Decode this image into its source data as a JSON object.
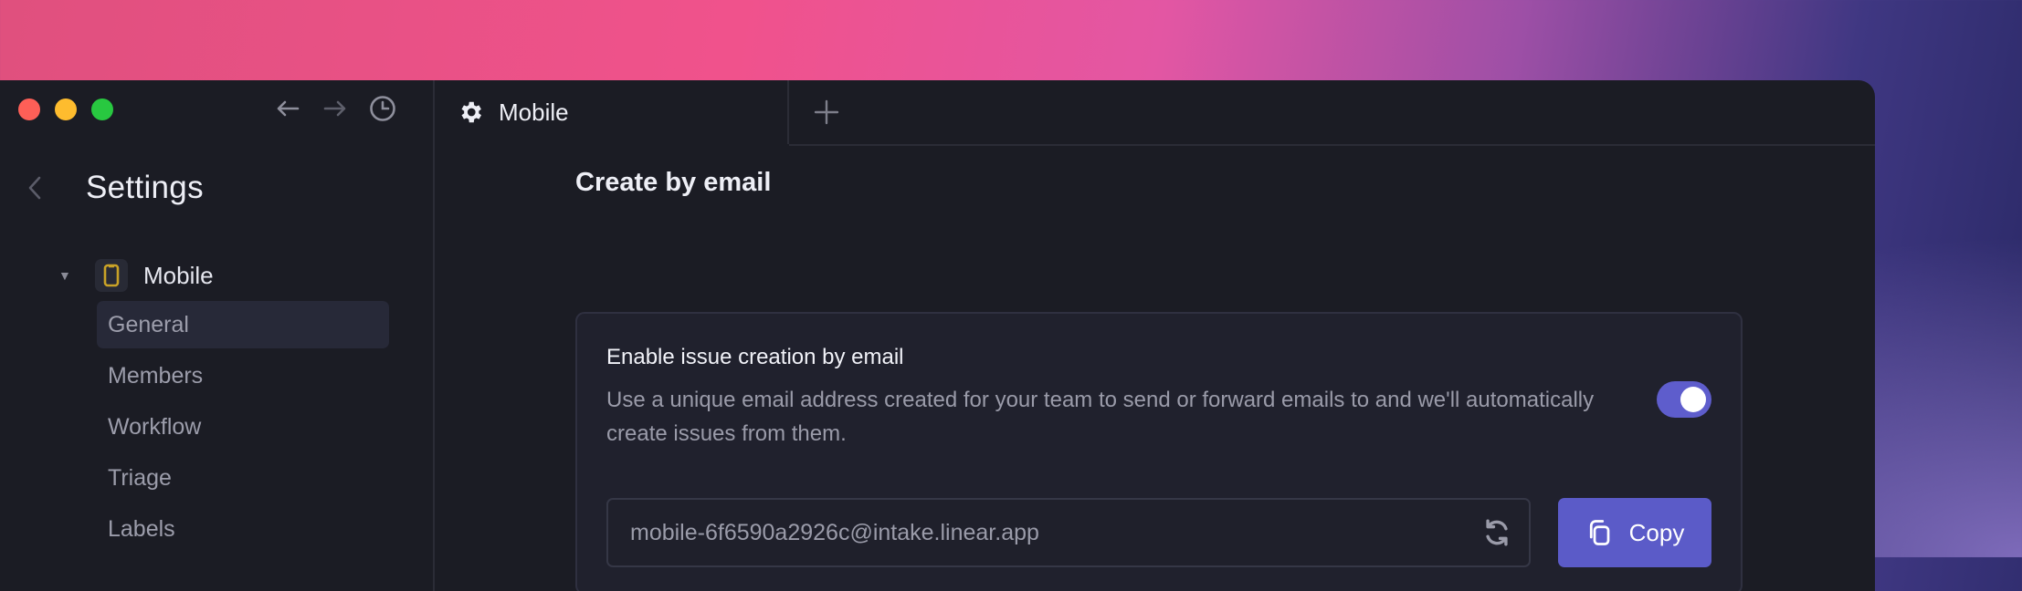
{
  "window": {
    "traffic_lights": [
      "close",
      "minimize",
      "zoom"
    ],
    "nav": {
      "back_icon": "arrow-left-icon",
      "forward_icon": "arrow-right-icon",
      "history_icon": "clock-icon"
    }
  },
  "sidebar": {
    "title": "Settings",
    "back_icon": "chevron-left-icon",
    "team": {
      "name": "Mobile",
      "icon": "phone-icon",
      "icon_color": "#c9a227",
      "expanded": true
    },
    "items": [
      {
        "label": "General",
        "active": true
      },
      {
        "label": "Members",
        "active": false
      },
      {
        "label": "Workflow",
        "active": false
      },
      {
        "label": "Triage",
        "active": false
      },
      {
        "label": "Labels",
        "active": false
      }
    ]
  },
  "tabs": [
    {
      "label": "Mobile",
      "icon": "gear-icon",
      "active": true
    }
  ],
  "new_tab_icon": "plus-icon",
  "main": {
    "section_title": "Create by email",
    "card": {
      "title": "Enable issue creation by email",
      "description": "Use a unique email address created for your team to send or forward emails to and we'll automatically create issues from them.",
      "toggle_on": true,
      "email_value": "mobile-6f6590a2926c@intake.linear.app",
      "refresh_icon": "refresh-icon",
      "copy_label": "Copy",
      "copy_icon": "copy-icon"
    }
  },
  "colors": {
    "accent": "#5b5bc8",
    "window_bg": "#1b1c24",
    "card_bg": "#20212d",
    "text_primary": "#eeeff6",
    "text_secondary": "#9a9ba9"
  }
}
